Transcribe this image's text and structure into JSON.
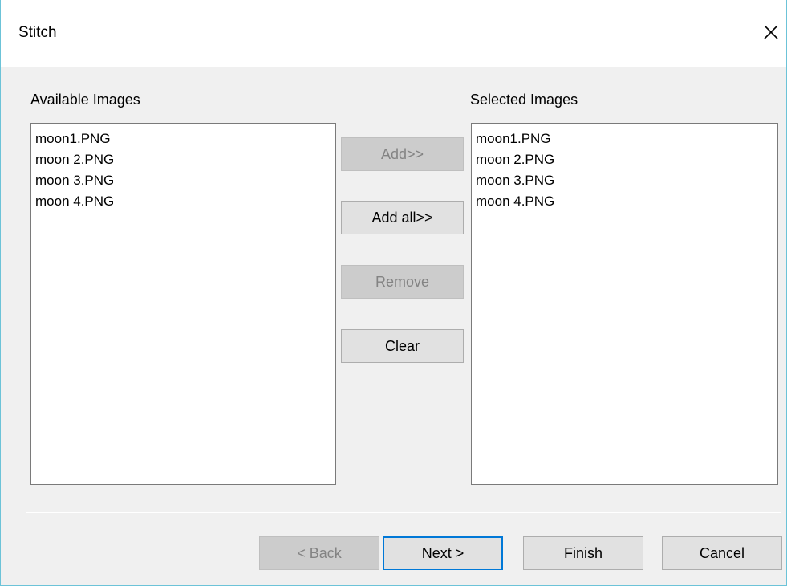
{
  "window": {
    "title": "Stitch",
    "close_label": "Close"
  },
  "available": {
    "label": "Available Images",
    "items": [
      "moon1.PNG",
      "moon 2.PNG",
      "moon 3.PNG",
      "moon 4.PNG"
    ]
  },
  "selected": {
    "label": "Selected Images",
    "items": [
      "moon1.PNG",
      "moon 2.PNG",
      "moon 3.PNG",
      "moon 4.PNG"
    ]
  },
  "actions": {
    "add": "Add>>",
    "add_all": "Add all>>",
    "remove": "Remove",
    "clear": "Clear"
  },
  "footer": {
    "back": "< Back",
    "next": "Next >",
    "finish": "Finish",
    "cancel": "Cancel"
  }
}
